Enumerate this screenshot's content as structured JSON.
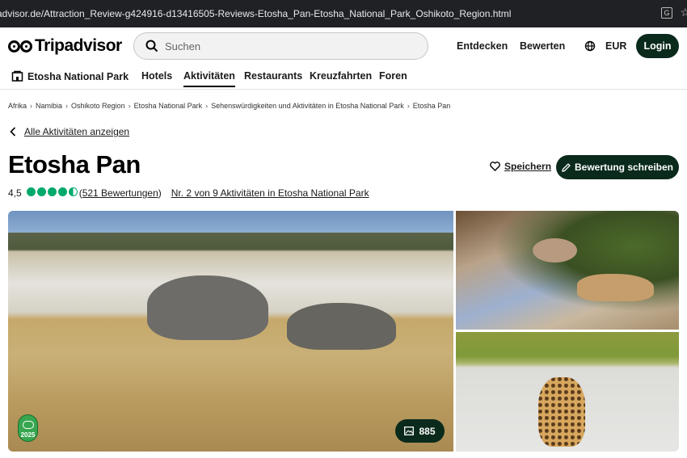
{
  "browser": {
    "url": "advisor.de/Attraction_Review-g424916-d13416505-Reviews-Etosha_Pan-Etosha_National_Park_Oshikoto_Region.html"
  },
  "header": {
    "logo_text": "Tripadvisor",
    "search_placeholder": "Suchen",
    "nav": {
      "explore": "Entdecken",
      "review": "Bewerten",
      "currency": "EUR",
      "login": "Login"
    }
  },
  "subnav": {
    "place": "Etosha National Park",
    "items": [
      "Hotels",
      "Aktivitäten",
      "Restaurants",
      "Kreuzfahrten",
      "Foren"
    ],
    "active": "Aktivitäten"
  },
  "breadcrumbs": [
    "Afrika",
    "Namibia",
    "Oshikoto Region",
    "Etosha National Park",
    "Sehenswürdigkeiten und Aktivitäten in Etosha National Park",
    "Etosha Pan"
  ],
  "back_link": "Alle Aktivitäten anzeigen",
  "title": "Etosha Pan",
  "actions": {
    "save": "Speichern",
    "write_review": "Bewertung schreiben"
  },
  "rating": {
    "score": "4,5",
    "bubbles_filled": 4.5,
    "reviews_open": "(",
    "reviews": "521 Bewertungen",
    "reviews_close": ")",
    "rank": "Nr. 2 von 9 Aktivitäten in Etosha National Park"
  },
  "gallery": {
    "photo_count": "885",
    "badge_year": "2025"
  },
  "colors": {
    "brand_dark": "#0a2a1c",
    "bubble_green": "#00aa6c",
    "badge_green": "#37a64f"
  }
}
